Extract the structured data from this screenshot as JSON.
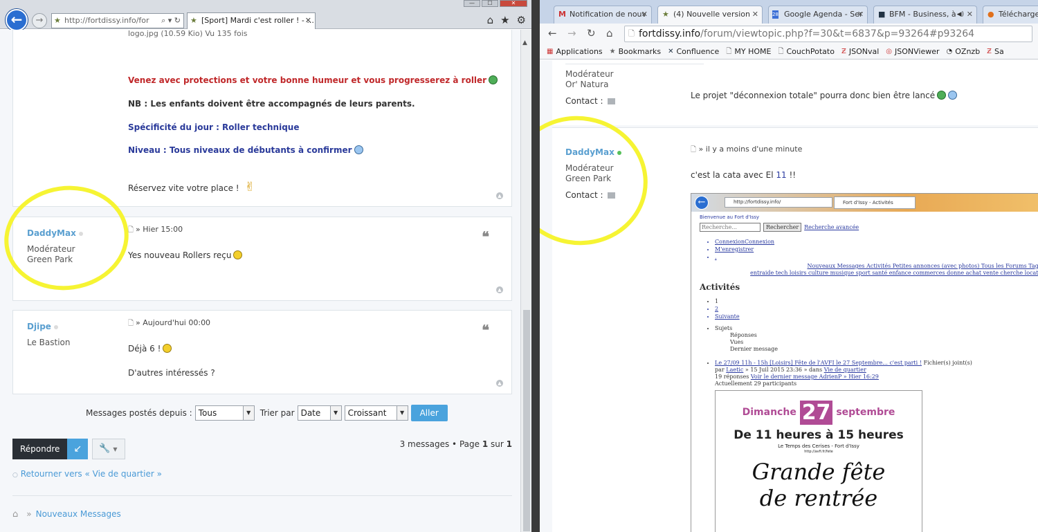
{
  "left": {
    "window_buttons": {
      "minimize": "—",
      "maximize": "☐",
      "close": "✕"
    },
    "address": "http://fortdissy.info/for",
    "tab_title": "[Sport] Mardi c'est roller ! - ...",
    "attachment_line": "logo.jpg (10.59 Kio) Vu 135 fois",
    "first_post_lines": {
      "red": "Venez avec protections et votre bonne humeur et vous progresserez à roller",
      "note": "NB : Les enfants doivent être accompagnés de leurs parents.",
      "specific": "Spécificité du jour : Roller technique",
      "level": "Niveau : Tous niveaux de débutants à confirmer",
      "reserve": "Réservez vite votre place !"
    },
    "posts": [
      {
        "author": "DaddyMax",
        "rank": "Modérateur",
        "location": "Green Park",
        "time": "» Hier 15:00",
        "text": "Yes nouveau Rollers reçu"
      },
      {
        "author": "Djipe",
        "rank": "Le Bastion",
        "time": "» Aujourd'hui 00:00",
        "text1": "Déjà 6 !",
        "text2": "D'autres intéressés ?"
      }
    ],
    "filters": {
      "since_label": "Messages postés depuis :",
      "since_value": "Tous",
      "sort_label": "Trier par",
      "sort_value": "Date",
      "order_value": "Croissant",
      "go": "Aller"
    },
    "reply_label": "Répondre",
    "pagination": {
      "prefix": "3 messages • Page",
      "page": "1",
      "sep": "sur",
      "total": "1"
    },
    "back_link": "Retourner vers « Vie de quartier »",
    "bottom_nav": "Nouveaux Messages"
  },
  "right": {
    "tabs": [
      {
        "label": "Notification de nouv",
        "icon": "M"
      },
      {
        "label": "(4) Nouvelle version",
        "icon": "★"
      },
      {
        "label": "Google Agenda - Ser",
        "icon": "28"
      },
      {
        "label": "BFM - Business, à",
        "icon": "■"
      },
      {
        "label": "Télécharger",
        "icon": "●"
      }
    ],
    "url_host": "fortdissy.info",
    "url_path": "/forum/viewtopic.php?f=30&t=6837&p=93264#p93264",
    "bookmarks": [
      "Applications",
      "Bookmarks",
      "Confluence",
      "MY HOME",
      "CouchPotato",
      "JSONval",
      "JSONViewer",
      "OZnzb",
      "Sa"
    ],
    "prev_post": {
      "rank": "Modérateur",
      "location": "Or' Natura",
      "contact": "Contact :",
      "text": "Le projet \"déconnexion totale\" pourra donc bien être lancé"
    },
    "post": {
      "author": "DaddyMax",
      "rank": "Modérateur",
      "location": "Green Park",
      "contact": "Contact :",
      "time": "» il y a moins d'une minute",
      "text_pre": "c'est la cata avec El ",
      "text_num": "11",
      "text_post": " !!"
    },
    "embed": {
      "address": "http://fortdissy.info/",
      "tab": "Fort d'Issy - Activités",
      "welcome": "Bienvenue au Fort d'Issy",
      "search_placeholder": "Recherche...",
      "search_button": "Rechercher",
      "advanced": "Recherche avancée",
      "top_links": [
        "ConnexionConnexion",
        "M'enregistrer",
        "."
      ],
      "nav_row1": "Nouveaux Messages Activités Petites annonces (avec photos) Tous les Forums Tags",
      "nav_row2": "entraide tech loisirs culture musique sport santé enfance commerces donne achat vente cherche location",
      "heading": "Activités",
      "pages": [
        "1",
        "2",
        "Suivante"
      ],
      "sujets": "Sujets",
      "columns": [
        "Réponses",
        "Vues",
        "Dernier message"
      ],
      "topic_link": "Le 27/09 11h - 15h [Loisirs] Fête de l'AVFI le 27 Septembre... c'est parti !",
      "topic_tail": " Fichier(s) joint(s)",
      "topic_by": "par ",
      "topic_author": "Laetic",
      "topic_date": " » 15 Juil 2015 23:36 » dans ",
      "topic_forum": "Vie de quartier",
      "topic_replies": "19 réponses ",
      "topic_last": "Voir le dernier message AdrienP » Hier 16:29",
      "topic_participants": "Actuellement 29 participants",
      "poster_day_pre": "Dimanche",
      "poster_day_num": "27",
      "poster_day_post": "septembre",
      "poster_hours": "De 11 heures à 15 heures",
      "poster_sub": "Le Temps des Cerises - Fort d'Issy",
      "poster_url": "http://avfi.fr/fete",
      "poster_big1": "Grande fête",
      "poster_big2": "de rentrée"
    }
  },
  "colors": {
    "highlight": "#f6f433",
    "username": "#5a9fd0",
    "accent": "#4aa3dd"
  }
}
